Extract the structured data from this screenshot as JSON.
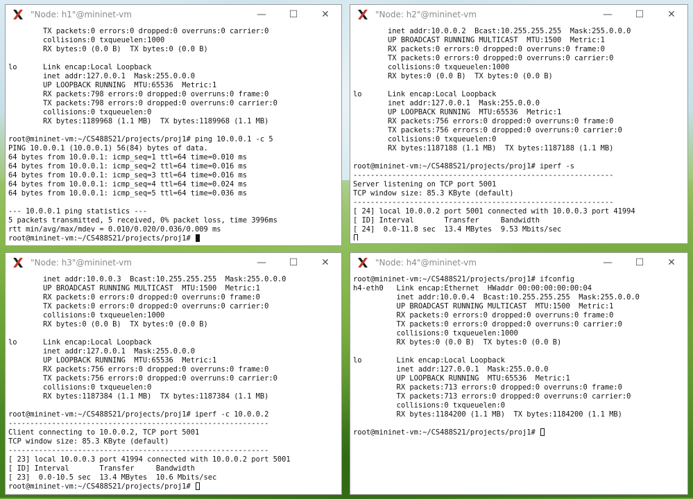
{
  "windows": [
    {
      "id": "h1",
      "title": "\"Node: h1\"@mininet-vm",
      "cursor": "solid",
      "lines": [
        "        TX packets:0 errors:0 dropped:0 overruns:0 carrier:0",
        "        collisions:0 txqueuelen:1000",
        "        RX bytes:0 (0.0 B)  TX bytes:0 (0.0 B)",
        "",
        "lo      Link encap:Local Loopback",
        "        inet addr:127.0.0.1  Mask:255.0.0.0",
        "        UP LOOPBACK RUNNING  MTU:65536  Metric:1",
        "        RX packets:798 errors:0 dropped:0 overruns:0 frame:0",
        "        TX packets:798 errors:0 dropped:0 overruns:0 carrier:0",
        "        collisions:0 txqueuelen:0",
        "        RX bytes:1189968 (1.1 MB)  TX bytes:1189968 (1.1 MB)",
        "",
        "root@mininet-vm:~/CS488S21/projects/proj1# ping 10.0.0.1 -c 5",
        "PING 10.0.0.1 (10.0.0.1) 56(84) bytes of data.",
        "64 bytes from 10.0.0.1: icmp_seq=1 ttl=64 time=0.010 ms",
        "64 bytes from 10.0.0.1: icmp_seq=2 ttl=64 time=0.016 ms",
        "64 bytes from 10.0.0.1: icmp_seq=3 ttl=64 time=0.016 ms",
        "64 bytes from 10.0.0.1: icmp_seq=4 ttl=64 time=0.024 ms",
        "64 bytes from 10.0.0.1: icmp_seq=5 ttl=64 time=0.036 ms",
        "",
        "--- 10.0.0.1 ping statistics ---",
        "5 packets transmitted, 5 received, 0% packet loss, time 3996ms",
        "rtt min/avg/max/mdev = 0.010/0.020/0.036/0.009 ms",
        "root@mininet-vm:~/CS488S21/projects/proj1# "
      ]
    },
    {
      "id": "h2",
      "title": "\"Node: h2\"@mininet-vm",
      "cursor": "hollow",
      "lines": [
        "        inet addr:10.0.0.2  Bcast:10.255.255.255  Mask:255.0.0.0",
        "        UP BROADCAST RUNNING MULTICAST  MTU:1500  Metric:1",
        "        RX packets:0 errors:0 dropped:0 overruns:0 frame:0",
        "        TX packets:0 errors:0 dropped:0 overruns:0 carrier:0",
        "        collisions:0 txqueuelen:1000",
        "        RX bytes:0 (0.0 B)  TX bytes:0 (0.0 B)",
        "",
        "lo      Link encap:Local Loopback",
        "        inet addr:127.0.0.1  Mask:255.0.0.0",
        "        UP LOOPBACK RUNNING  MTU:65536  Metric:1",
        "        RX packets:756 errors:0 dropped:0 overruns:0 frame:0",
        "        TX packets:756 errors:0 dropped:0 overruns:0 carrier:0",
        "        collisions:0 txqueuelen:0",
        "        RX bytes:1187188 (1.1 MB)  TX bytes:1187188 (1.1 MB)",
        "",
        "root@mininet-vm:~/CS488S21/projects/proj1# iperf -s",
        "------------------------------------------------------------",
        "Server listening on TCP port 5001",
        "TCP window size: 85.3 KByte (default)",
        "------------------------------------------------------------",
        "[ 24] local 10.0.0.2 port 5001 connected with 10.0.0.3 port 41994",
        "[ ID] Interval       Transfer     Bandwidth",
        "[ 24]  0.0-11.8 sec  13.4 MBytes  9.53 Mbits/sec",
        ""
      ]
    },
    {
      "id": "h3",
      "title": "\"Node: h3\"@mininet-vm",
      "cursor": "hollow",
      "lines": [
        "        inet addr:10.0.0.3  Bcast:10.255.255.255  Mask:255.0.0.0",
        "        UP BROADCAST RUNNING MULTICAST  MTU:1500  Metric:1",
        "        RX packets:0 errors:0 dropped:0 overruns:0 frame:0",
        "        TX packets:0 errors:0 dropped:0 overruns:0 carrier:0",
        "        collisions:0 txqueuelen:1000",
        "        RX bytes:0 (0.0 B)  TX bytes:0 (0.0 B)",
        "",
        "lo      Link encap:Local Loopback",
        "        inet addr:127.0.0.1  Mask:255.0.0.0",
        "        UP LOOPBACK RUNNING  MTU:65536  Metric:1",
        "        RX packets:756 errors:0 dropped:0 overruns:0 frame:0",
        "        TX packets:756 errors:0 dropped:0 overruns:0 carrier:0",
        "        collisions:0 txqueuelen:0",
        "        RX bytes:1187384 (1.1 MB)  TX bytes:1187384 (1.1 MB)",
        "",
        "root@mininet-vm:~/CS488S21/projects/proj1# iperf -c 10.0.0.2",
        "------------------------------------------------------------",
        "Client connecting to 10.0.0.2, TCP port 5001",
        "TCP window size: 85.3 KByte (default)",
        "------------------------------------------------------------",
        "[ 23] local 10.0.0.3 port 41994 connected with 10.0.0.2 port 5001",
        "[ ID] Interval       Transfer     Bandwidth",
        "[ 23]  0.0-10.5 sec  13.4 MBytes  10.6 Mbits/sec",
        "root@mininet-vm:~/CS488S21/projects/proj1# "
      ]
    },
    {
      "id": "h4",
      "title": "\"Node: h4\"@mininet-vm",
      "cursor": "hollow",
      "lines": [
        "root@mininet-vm:~/CS488S21/projects/proj1# ifconfig",
        "h4-eth0   Link encap:Ethernet  HWaddr 00:00:00:00:00:04",
        "          inet addr:10.0.0.4  Bcast:10.255.255.255  Mask:255.0.0.0",
        "          UP BROADCAST RUNNING MULTICAST  MTU:1500  Metric:1",
        "          RX packets:0 errors:0 dropped:0 overruns:0 frame:0",
        "          TX packets:0 errors:0 dropped:0 overruns:0 carrier:0",
        "          collisions:0 txqueuelen:1000",
        "          RX bytes:0 (0.0 B)  TX bytes:0 (0.0 B)",
        "",
        "lo        Link encap:Local Loopback",
        "          inet addr:127.0.0.1  Mask:255.0.0.0",
        "          UP LOOPBACK RUNNING  MTU:65536  Metric:1",
        "          RX packets:713 errors:0 dropped:0 overruns:0 frame:0",
        "          TX packets:713 errors:0 dropped:0 overruns:0 carrier:0",
        "          collisions:0 txqueuelen:0",
        "          RX bytes:1184200 (1.1 MB)  TX bytes:1184200 (1.1 MB)",
        "",
        "root@mininet-vm:~/CS488S21/projects/proj1# "
      ]
    }
  ],
  "controls": {
    "minimize": "—",
    "maximize": "☐",
    "close": "✕"
  }
}
